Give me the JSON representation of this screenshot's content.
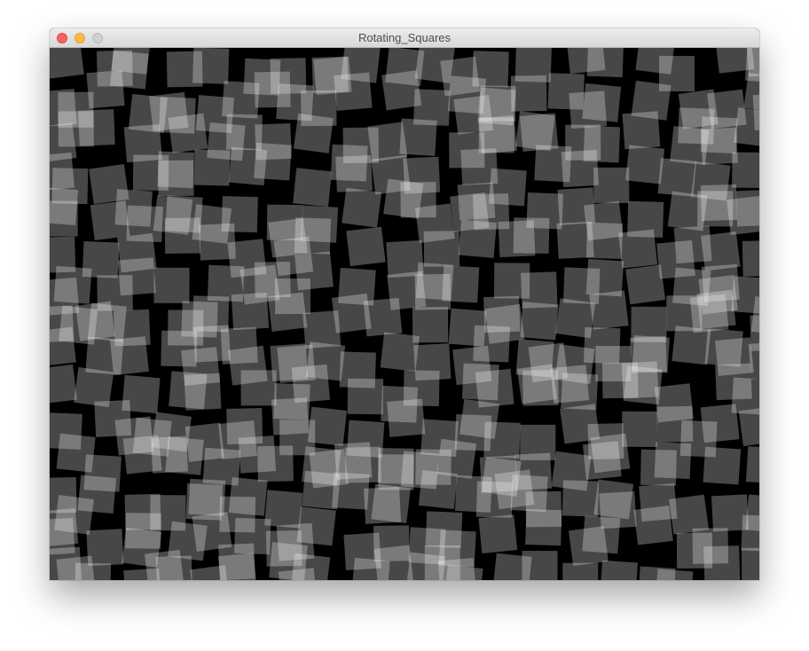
{
  "window": {
    "title": "Rotating_Squares",
    "controls": {
      "close_icon": "close-icon",
      "minimize_icon": "minimize-icon",
      "maximize_icon": "maximize-icon"
    }
  },
  "canvas": {
    "background": "#000000",
    "square_fill": "#ffffff",
    "square_opacity": 0.28
  }
}
